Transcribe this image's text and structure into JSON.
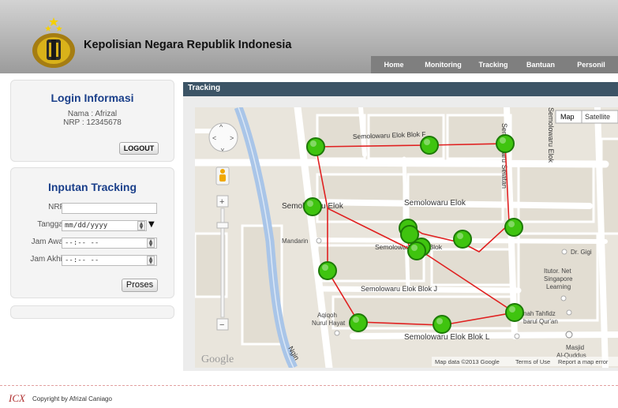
{
  "header": {
    "site_title": "Kepolisian Negara Republik Indonesia",
    "nav": [
      {
        "label": "Home"
      },
      {
        "label": "Monitoring"
      },
      {
        "label": "Tracking"
      },
      {
        "label": "Bantuan"
      },
      {
        "label": "Personil"
      }
    ]
  },
  "login": {
    "title": "Login Informasi",
    "name": "Nama : Afrizal",
    "nrp": "NRP : 12345678",
    "logout": "LOGOUT"
  },
  "tracking_form": {
    "title": "Inputan Tracking",
    "nrp_label": "NRP:",
    "nrp_value": "",
    "date_label": "Tanggal:",
    "date_placeholder": "mm/dd/yyyy",
    "start_label": "Jam Awal:",
    "start_placeholder": "--:-- --",
    "end_label": "Jam Akhir:",
    "end_placeholder": "--:-- --",
    "submit": "Proses"
  },
  "main": {
    "title": "Tracking"
  },
  "map": {
    "type_buttons": [
      "Map",
      "Satellite"
    ],
    "streets": {
      "blok_f": "Semolowaru Elok Blok F",
      "elok_h": "Semolowaru Elok",
      "elok_h2": "Semolowaru Elok",
      "elok_vertical": "Semolowaru Elok",
      "selatan": "Semolowaru Selatan",
      "blok_j": "Semolowaru Elok Blok J",
      "blok_l": "Semolowaru Elok Blok L",
      "blok_mid": "Semolowaru Elok Blok",
      "ngin": "Ngin"
    },
    "places": {
      "mandarin": "Mandarin",
      "dr_gigi": "Dr. Gigi",
      "itutor_1": "Itutor. Net",
      "itutor_2": "Singapore",
      "itutor_3": "Learning",
      "aqiqoh_1": "Aqiqoh",
      "aqiqoh_2": "Nurul Hayat",
      "tahfidz_1": "nah Tahfidz",
      "tahfidz_2": "barul Qur'an",
      "masjid_1": "Masjid",
      "masjid_2": "Al-Quddus"
    },
    "attribution": "Map data ©2013 Google",
    "terms": "Terms of Use",
    "report": "Report a map error",
    "google_logo": "Google",
    "marker_color": "#3fc40f",
    "route_color": "#e02020"
  },
  "footer": {
    "logo_text": "ICX",
    "copyright": "Copyright by Afrizal Caniago"
  }
}
